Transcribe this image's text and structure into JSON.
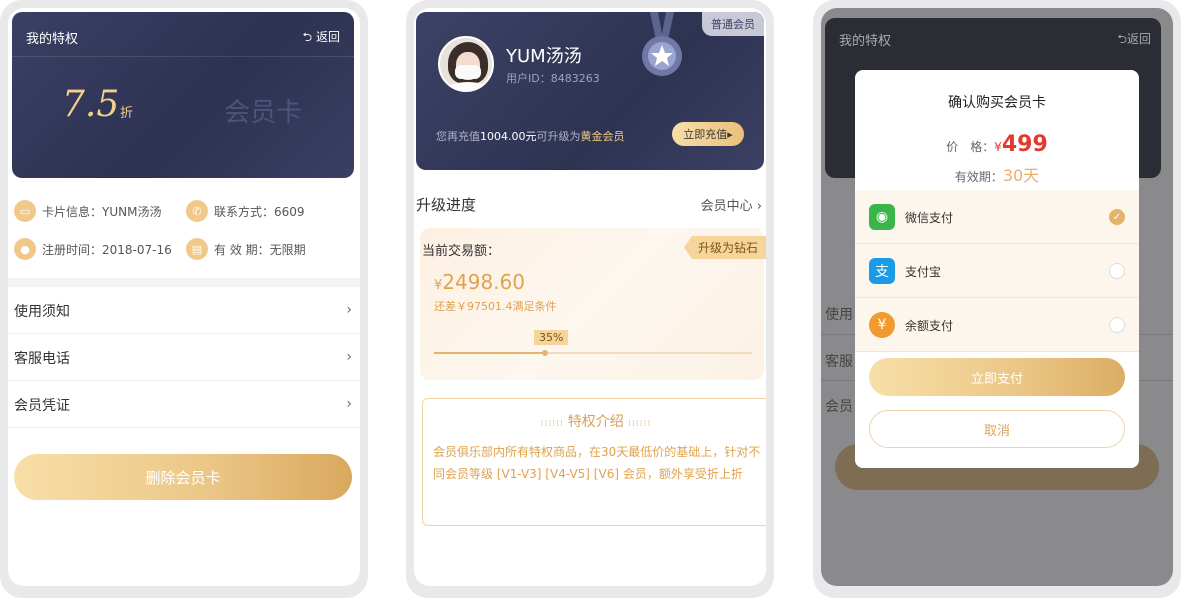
{
  "screen1": {
    "header": {
      "title": "我的特权",
      "back_label": "返回",
      "back_icon": "return-arrow-icon"
    },
    "card": {
      "discount": "7.5",
      "discount_unit": "折",
      "card_label": "会员卡"
    },
    "info": {
      "card_info": "卡片信息：YUNM汤汤",
      "contact": "联系方式：6609",
      "register_time": "注册时间：2018-07-16",
      "validity": "有 效 期：无限期"
    },
    "menu": [
      "使用须知",
      "客服电话",
      "会员凭证"
    ],
    "delete_button": "删除会员卡"
  },
  "screen2": {
    "level_badge": "普通会员",
    "user": {
      "name": "YUM汤汤",
      "user_id": "用户ID：8483263"
    },
    "upgrade_tip": {
      "prefix": "您再充值",
      "amount": "1004.00元",
      "middle": "可升级为",
      "target": "黄金会员"
    },
    "recharge_button": "立即充值",
    "section_title": "升级进度",
    "section_link": "会员中心",
    "progress": {
      "label": "当前交易额：",
      "flag": "升级为钻石",
      "currency": "¥",
      "amount": "2498.60",
      "need_text": "还差￥97501.4满足条件",
      "percent_label": "35%",
      "percent": 35
    },
    "intro": {
      "title": "特权介绍",
      "text": "会员俱乐部内所有特权商品，在30天最低价的基础上，针对不同会员等级 [V1-V3] [V4-V5] [V6] 会员，额外享受折上折"
    }
  },
  "screen3": {
    "bg": {
      "title": "我的特权",
      "back_label": "返回",
      "rows": [
        "使用",
        "客服",
        "会员"
      ],
      "button": "删除会员卡"
    },
    "modal": {
      "title": "确认购买会员卡",
      "price_label": "价　格：",
      "price_currency": "¥",
      "price_value": "499",
      "validity_label": "有效期：",
      "validity_value": "30天",
      "payment_methods": [
        {
          "name": "微信支付",
          "icon": "wechat-pay-icon",
          "color": "#3ab54a",
          "selected": true
        },
        {
          "name": "支付宝",
          "icon": "alipay-icon",
          "color": "#1a9be8",
          "selected": false
        },
        {
          "name": "余额支付",
          "icon": "balance-bag-icon",
          "color": "#f29a2e",
          "selected": false
        }
      ],
      "pay_button": "立即支付",
      "cancel_button": "取消"
    }
  }
}
